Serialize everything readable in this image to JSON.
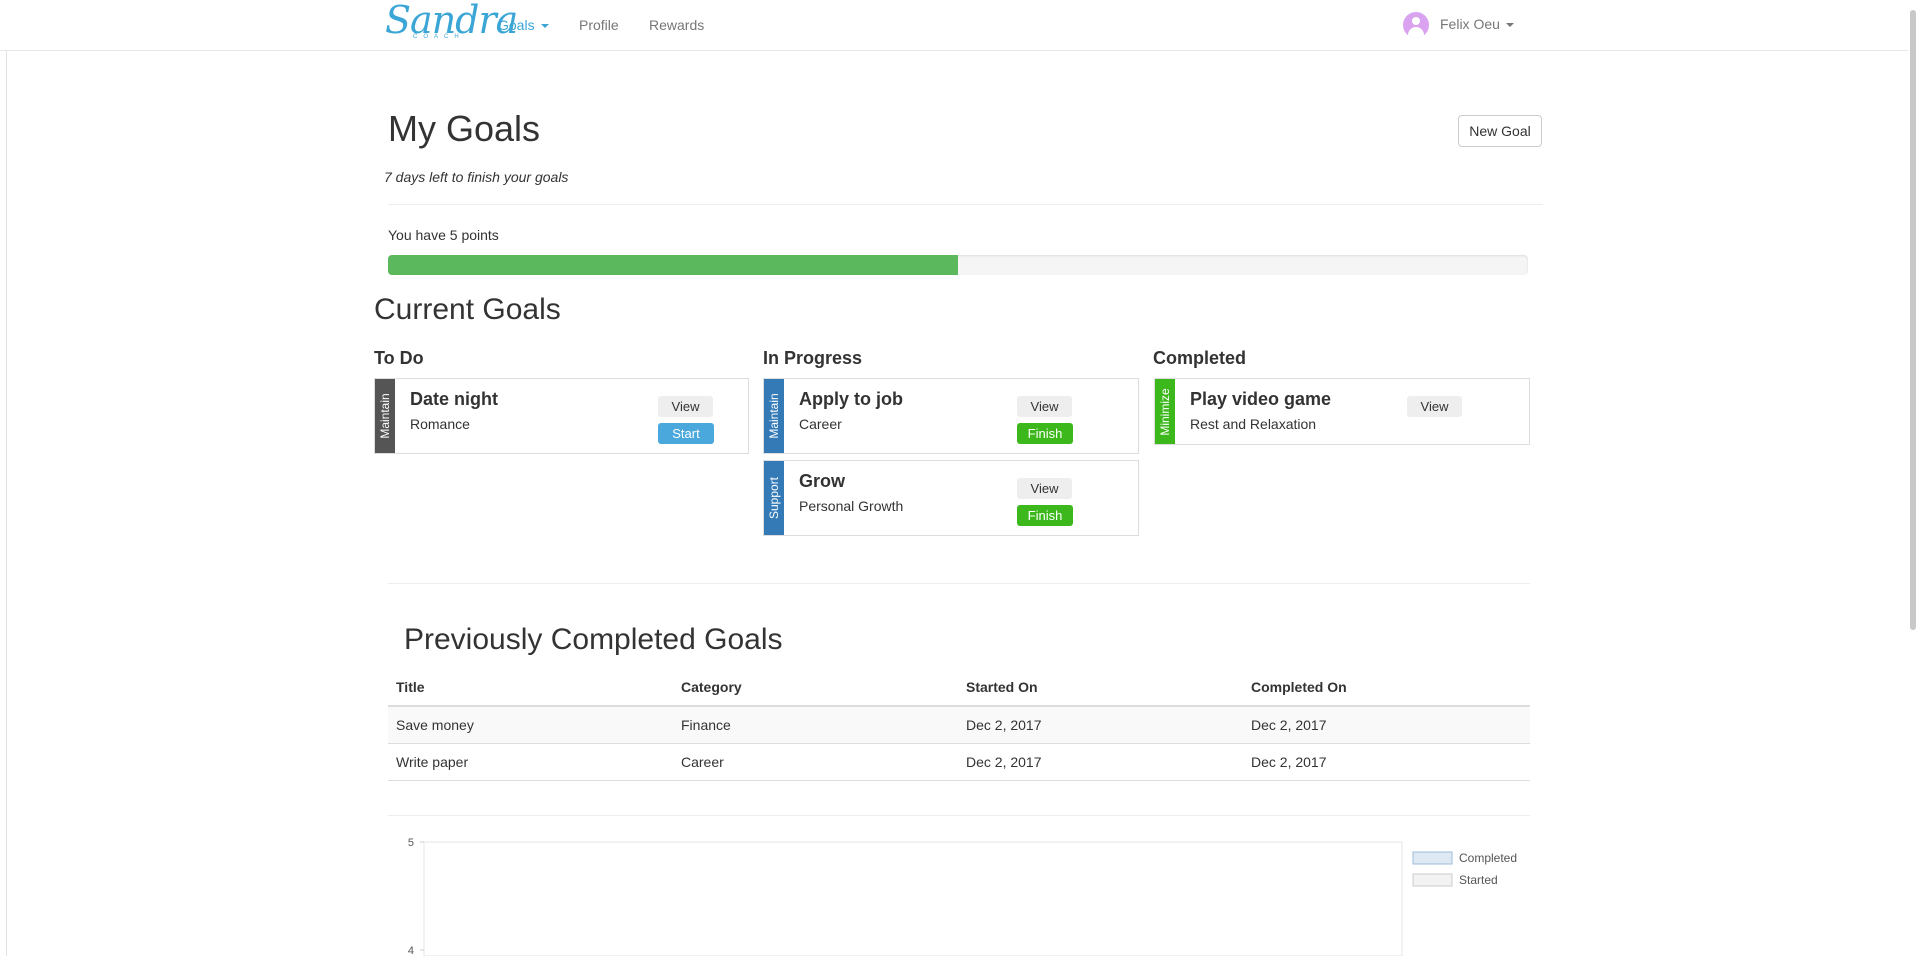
{
  "nav": {
    "brand": "Sandra",
    "brand_sub": "COACH",
    "links": [
      "Goals",
      "Profile",
      "Rewards"
    ],
    "user_name": "Felix Oeu"
  },
  "header": {
    "title": "My Goals",
    "new_goal_label": "New Goal",
    "days_left": "7 days left to finish your goals"
  },
  "points": {
    "text": "You have 5 points",
    "progress_fraction": 0.5,
    "color": "#5cb85c"
  },
  "current": {
    "title": "Current Goals",
    "columns": [
      "To Do",
      "In Progress",
      "Completed"
    ],
    "cards": [
      {
        "tag": "Maintain",
        "tag_color": "#555555",
        "title": "Date night",
        "category": "Romance",
        "view": "View",
        "action": "Start"
      },
      {
        "tag": "Maintain",
        "tag_color": "#337ab7",
        "title": "Apply to job",
        "category": "Career",
        "view": "View",
        "action": "Finish"
      },
      {
        "tag": "Support",
        "tag_color": "#337ab7",
        "title": "Grow",
        "category": "Personal Growth",
        "view": "View",
        "action": "Finish"
      },
      {
        "tag": "Minimize",
        "tag_color": "#3cb81c",
        "title": "Play video game",
        "category": "Rest and Relaxation",
        "view": "View"
      }
    ]
  },
  "previous": {
    "title": "Previously Completed Goals",
    "headers": [
      "Title",
      "Category",
      "Started On",
      "Completed On"
    ],
    "rows": [
      [
        "Save money",
        "Finance",
        "Dec 2, 2017",
        "Dec 2, 2017"
      ],
      [
        "Write paper",
        "Career",
        "Dec 2, 2017",
        "Dec 2, 2017"
      ]
    ]
  },
  "chart_data": {
    "type": "bar",
    "title": "",
    "xlabel": "",
    "ylabel": "",
    "yticks": [
      "5",
      "4"
    ],
    "series": [
      {
        "name": "Completed",
        "values": [],
        "color": "#dfe9f3"
      },
      {
        "name": "Started",
        "values": [],
        "color": "#f2f2f2"
      }
    ],
    "legend": "top-right",
    "grid": false
  }
}
